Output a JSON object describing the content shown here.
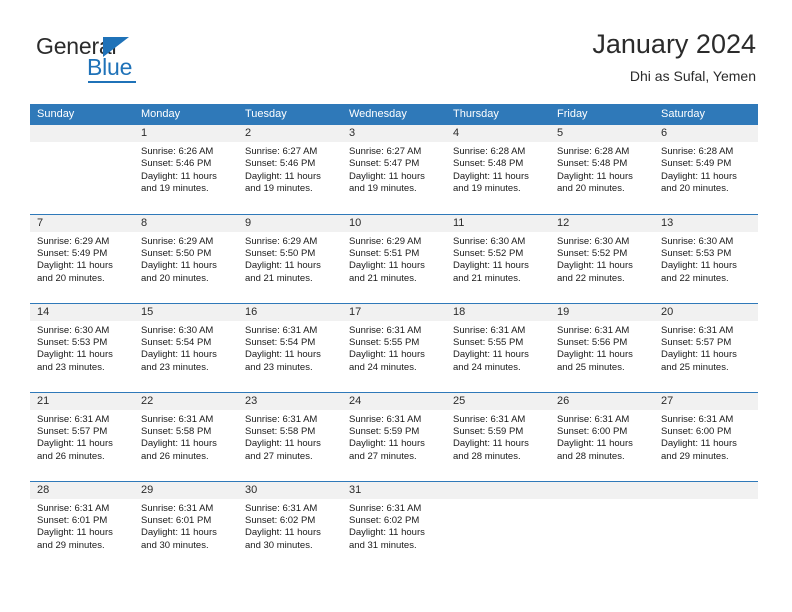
{
  "brand": {
    "name_part1": "General",
    "name_part2": "Blue",
    "accent_color": "#1f72b8"
  },
  "header": {
    "title": "January 2024",
    "subtitle": "Dhi as Sufal, Yemen"
  },
  "theme": {
    "header_row_bg": "#2f79b9",
    "daynum_bg": "#f1f1f1",
    "text_color": "#2b2b2b"
  },
  "weekdays": [
    "Sunday",
    "Monday",
    "Tuesday",
    "Wednesday",
    "Thursday",
    "Friday",
    "Saturday"
  ],
  "weeks": [
    [
      {
        "day": "",
        "sunrise": "",
        "sunset": "",
        "daylight1": "",
        "daylight2": ""
      },
      {
        "day": "1",
        "sunrise": "Sunrise: 6:26 AM",
        "sunset": "Sunset: 5:46 PM",
        "daylight1": "Daylight: 11 hours",
        "daylight2": "and 19 minutes."
      },
      {
        "day": "2",
        "sunrise": "Sunrise: 6:27 AM",
        "sunset": "Sunset: 5:46 PM",
        "daylight1": "Daylight: 11 hours",
        "daylight2": "and 19 minutes."
      },
      {
        "day": "3",
        "sunrise": "Sunrise: 6:27 AM",
        "sunset": "Sunset: 5:47 PM",
        "daylight1": "Daylight: 11 hours",
        "daylight2": "and 19 minutes."
      },
      {
        "day": "4",
        "sunrise": "Sunrise: 6:28 AM",
        "sunset": "Sunset: 5:48 PM",
        "daylight1": "Daylight: 11 hours",
        "daylight2": "and 19 minutes."
      },
      {
        "day": "5",
        "sunrise": "Sunrise: 6:28 AM",
        "sunset": "Sunset: 5:48 PM",
        "daylight1": "Daylight: 11 hours",
        "daylight2": "and 20 minutes."
      },
      {
        "day": "6",
        "sunrise": "Sunrise: 6:28 AM",
        "sunset": "Sunset: 5:49 PM",
        "daylight1": "Daylight: 11 hours",
        "daylight2": "and 20 minutes."
      }
    ],
    [
      {
        "day": "7",
        "sunrise": "Sunrise: 6:29 AM",
        "sunset": "Sunset: 5:49 PM",
        "daylight1": "Daylight: 11 hours",
        "daylight2": "and 20 minutes."
      },
      {
        "day": "8",
        "sunrise": "Sunrise: 6:29 AM",
        "sunset": "Sunset: 5:50 PM",
        "daylight1": "Daylight: 11 hours",
        "daylight2": "and 20 minutes."
      },
      {
        "day": "9",
        "sunrise": "Sunrise: 6:29 AM",
        "sunset": "Sunset: 5:50 PM",
        "daylight1": "Daylight: 11 hours",
        "daylight2": "and 21 minutes."
      },
      {
        "day": "10",
        "sunrise": "Sunrise: 6:29 AM",
        "sunset": "Sunset: 5:51 PM",
        "daylight1": "Daylight: 11 hours",
        "daylight2": "and 21 minutes."
      },
      {
        "day": "11",
        "sunrise": "Sunrise: 6:30 AM",
        "sunset": "Sunset: 5:52 PM",
        "daylight1": "Daylight: 11 hours",
        "daylight2": "and 21 minutes."
      },
      {
        "day": "12",
        "sunrise": "Sunrise: 6:30 AM",
        "sunset": "Sunset: 5:52 PM",
        "daylight1": "Daylight: 11 hours",
        "daylight2": "and 22 minutes."
      },
      {
        "day": "13",
        "sunrise": "Sunrise: 6:30 AM",
        "sunset": "Sunset: 5:53 PM",
        "daylight1": "Daylight: 11 hours",
        "daylight2": "and 22 minutes."
      }
    ],
    [
      {
        "day": "14",
        "sunrise": "Sunrise: 6:30 AM",
        "sunset": "Sunset: 5:53 PM",
        "daylight1": "Daylight: 11 hours",
        "daylight2": "and 23 minutes."
      },
      {
        "day": "15",
        "sunrise": "Sunrise: 6:30 AM",
        "sunset": "Sunset: 5:54 PM",
        "daylight1": "Daylight: 11 hours",
        "daylight2": "and 23 minutes."
      },
      {
        "day": "16",
        "sunrise": "Sunrise: 6:31 AM",
        "sunset": "Sunset: 5:54 PM",
        "daylight1": "Daylight: 11 hours",
        "daylight2": "and 23 minutes."
      },
      {
        "day": "17",
        "sunrise": "Sunrise: 6:31 AM",
        "sunset": "Sunset: 5:55 PM",
        "daylight1": "Daylight: 11 hours",
        "daylight2": "and 24 minutes."
      },
      {
        "day": "18",
        "sunrise": "Sunrise: 6:31 AM",
        "sunset": "Sunset: 5:55 PM",
        "daylight1": "Daylight: 11 hours",
        "daylight2": "and 24 minutes."
      },
      {
        "day": "19",
        "sunrise": "Sunrise: 6:31 AM",
        "sunset": "Sunset: 5:56 PM",
        "daylight1": "Daylight: 11 hours",
        "daylight2": "and 25 minutes."
      },
      {
        "day": "20",
        "sunrise": "Sunrise: 6:31 AM",
        "sunset": "Sunset: 5:57 PM",
        "daylight1": "Daylight: 11 hours",
        "daylight2": "and 25 minutes."
      }
    ],
    [
      {
        "day": "21",
        "sunrise": "Sunrise: 6:31 AM",
        "sunset": "Sunset: 5:57 PM",
        "daylight1": "Daylight: 11 hours",
        "daylight2": "and 26 minutes."
      },
      {
        "day": "22",
        "sunrise": "Sunrise: 6:31 AM",
        "sunset": "Sunset: 5:58 PM",
        "daylight1": "Daylight: 11 hours",
        "daylight2": "and 26 minutes."
      },
      {
        "day": "23",
        "sunrise": "Sunrise: 6:31 AM",
        "sunset": "Sunset: 5:58 PM",
        "daylight1": "Daylight: 11 hours",
        "daylight2": "and 27 minutes."
      },
      {
        "day": "24",
        "sunrise": "Sunrise: 6:31 AM",
        "sunset": "Sunset: 5:59 PM",
        "daylight1": "Daylight: 11 hours",
        "daylight2": "and 27 minutes."
      },
      {
        "day": "25",
        "sunrise": "Sunrise: 6:31 AM",
        "sunset": "Sunset: 5:59 PM",
        "daylight1": "Daylight: 11 hours",
        "daylight2": "and 28 minutes."
      },
      {
        "day": "26",
        "sunrise": "Sunrise: 6:31 AM",
        "sunset": "Sunset: 6:00 PM",
        "daylight1": "Daylight: 11 hours",
        "daylight2": "and 28 minutes."
      },
      {
        "day": "27",
        "sunrise": "Sunrise: 6:31 AM",
        "sunset": "Sunset: 6:00 PM",
        "daylight1": "Daylight: 11 hours",
        "daylight2": "and 29 minutes."
      }
    ],
    [
      {
        "day": "28",
        "sunrise": "Sunrise: 6:31 AM",
        "sunset": "Sunset: 6:01 PM",
        "daylight1": "Daylight: 11 hours",
        "daylight2": "and 29 minutes."
      },
      {
        "day": "29",
        "sunrise": "Sunrise: 6:31 AM",
        "sunset": "Sunset: 6:01 PM",
        "daylight1": "Daylight: 11 hours",
        "daylight2": "and 30 minutes."
      },
      {
        "day": "30",
        "sunrise": "Sunrise: 6:31 AM",
        "sunset": "Sunset: 6:02 PM",
        "daylight1": "Daylight: 11 hours",
        "daylight2": "and 30 minutes."
      },
      {
        "day": "31",
        "sunrise": "Sunrise: 6:31 AM",
        "sunset": "Sunset: 6:02 PM",
        "daylight1": "Daylight: 11 hours",
        "daylight2": "and 31 minutes."
      },
      {
        "day": "",
        "sunrise": "",
        "sunset": "",
        "daylight1": "",
        "daylight2": ""
      },
      {
        "day": "",
        "sunrise": "",
        "sunset": "",
        "daylight1": "",
        "daylight2": ""
      },
      {
        "day": "",
        "sunrise": "",
        "sunset": "",
        "daylight1": "",
        "daylight2": ""
      }
    ]
  ]
}
